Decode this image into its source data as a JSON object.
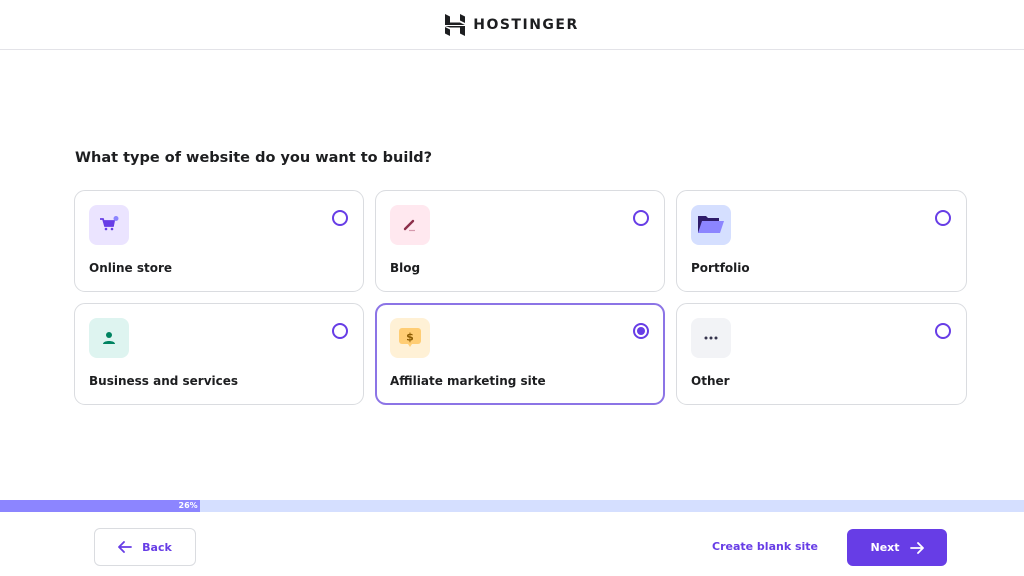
{
  "header": {
    "brand": "HOSTINGER"
  },
  "question": "What type of website do you want to build?",
  "options": [
    {
      "label": "Online store",
      "icon": "shopping-cart-icon",
      "icon_bg": "#ebe4ff",
      "icon_color": "#673de6",
      "selected": false
    },
    {
      "label": "Blog",
      "icon": "pen-icon",
      "icon_bg": "#ffe8ef",
      "icon_color": "#8c2f4a",
      "selected": false
    },
    {
      "label": "Portfolio",
      "icon": "folder-icon",
      "icon_bg": "#d5dfff",
      "icon_color": "#8c85ff",
      "selected": false
    },
    {
      "label": "Business and services",
      "icon": "person-icon",
      "icon_bg": "#def4f0",
      "icon_color": "#008361",
      "selected": false
    },
    {
      "label": "Affiliate marketing site",
      "icon": "dollar-chat-icon",
      "icon_bg": "#fff1d6",
      "icon_color": "#ffcd74",
      "selected": true
    },
    {
      "label": "Other",
      "icon": "more-dots-icon",
      "icon_bg": "#f2f3f6",
      "icon_color": "#36344d",
      "selected": false
    }
  ],
  "progress": {
    "percent": 26,
    "label": "26%"
  },
  "footer": {
    "back_label": "Back",
    "blank_label": "Create blank site",
    "next_label": "Next"
  },
  "colors": {
    "accent": "#673de6",
    "progress_fill": "#8c85ff",
    "progress_track": "#d5dfff"
  }
}
